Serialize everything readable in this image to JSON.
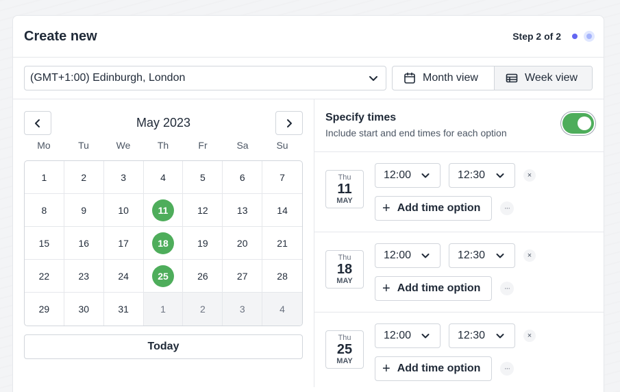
{
  "header": {
    "title": "Create new",
    "step": "Step 2 of 2"
  },
  "toolbar": {
    "timezone": "(GMT+1:00) Edinburgh, London",
    "month_view": "Month view",
    "week_view": "Week view"
  },
  "calendar": {
    "month_label": "May 2023",
    "weekdays": [
      "Mo",
      "Tu",
      "We",
      "Th",
      "Fr",
      "Sa",
      "Su"
    ],
    "days": [
      {
        "d": "1"
      },
      {
        "d": "2"
      },
      {
        "d": "3"
      },
      {
        "d": "4"
      },
      {
        "d": "5"
      },
      {
        "d": "6"
      },
      {
        "d": "7"
      },
      {
        "d": "8"
      },
      {
        "d": "9"
      },
      {
        "d": "10"
      },
      {
        "d": "11",
        "selected": true
      },
      {
        "d": "12"
      },
      {
        "d": "13"
      },
      {
        "d": "14"
      },
      {
        "d": "15"
      },
      {
        "d": "16"
      },
      {
        "d": "17"
      },
      {
        "d": "18",
        "selected": true
      },
      {
        "d": "19"
      },
      {
        "d": "20"
      },
      {
        "d": "21"
      },
      {
        "d": "22"
      },
      {
        "d": "23"
      },
      {
        "d": "24"
      },
      {
        "d": "25",
        "selected": true
      },
      {
        "d": "26"
      },
      {
        "d": "27"
      },
      {
        "d": "28"
      },
      {
        "d": "29"
      },
      {
        "d": "30"
      },
      {
        "d": "31"
      },
      {
        "d": "1",
        "muted": true
      },
      {
        "d": "2",
        "muted": true
      },
      {
        "d": "3",
        "muted": true
      },
      {
        "d": "4",
        "muted": true
      }
    ],
    "today_label": "Today"
  },
  "times": {
    "title": "Specify times",
    "subtitle": "Include start and end times for each option",
    "toggle_on": true,
    "add_label": "Add time option",
    "remove_glyph": "×",
    "more_glyph": "···",
    "options": [
      {
        "dow": "Thu",
        "day": "11",
        "month": "MAY",
        "start": "12:00",
        "end": "12:30"
      },
      {
        "dow": "Thu",
        "day": "18",
        "month": "MAY",
        "start": "12:00",
        "end": "12:30"
      },
      {
        "dow": "Thu",
        "day": "25",
        "month": "MAY",
        "start": "12:00",
        "end": "12:30"
      }
    ]
  },
  "colors": {
    "accent_green": "#4ead5b",
    "step_dot": "#6366f1"
  }
}
